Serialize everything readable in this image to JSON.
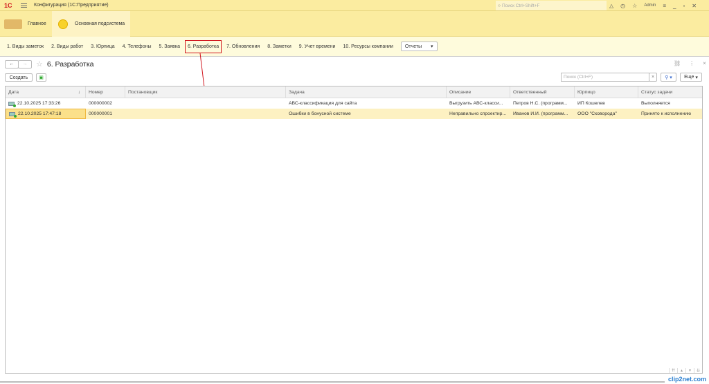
{
  "window": {
    "title": "Конфигурация  (1С:Предприятие)",
    "search_placeholder": "Поиск Ctrl+Shift+F",
    "user": "Admin",
    "logo": "1С"
  },
  "sections": [
    {
      "label": "Главное"
    },
    {
      "label": "Основная подсистема"
    }
  ],
  "nav": [
    "1. Виды заметок",
    "2. Виды работ",
    "3. Юрпица",
    "4. Телефоны",
    "5. Заявка",
    "6. Разработка",
    "7. Обновления",
    "8. Заметки",
    "9. Учет времени",
    "10. Ресурсы компании"
  ],
  "reports_label": "Отчеты",
  "form": {
    "title": "6. Разработка",
    "create_label": "Создать",
    "search_placeholder": "Поиск (Ctrl+F)",
    "more_label": "Еще"
  },
  "table": {
    "columns": [
      "Дата",
      "Номер",
      "Постановщик",
      "Задача",
      "Описание",
      "Ответственный",
      "Юрпицо",
      "Статус задачи"
    ],
    "rows": [
      [
        "22.10.2025 17:33:26",
        "000000002",
        "",
        "АВС-классификация для сайта",
        "Выгрузить АВС-класси...",
        "Петров Н.С. (программ...",
        "ИП Кошелев",
        "Выполняется"
      ],
      [
        "22.10.2025 17:47:18",
        "000000001",
        "",
        "Ошибки в бонусной системе",
        "Неправильно спроектир...",
        "Иванов И.И. (программ...",
        "ООО \"Сковорода\"",
        "Принято к исполнению"
      ]
    ]
  },
  "watermark": "clip2net.com",
  "colors": {
    "accent": "#fbeca0",
    "highlight": "#d0131b",
    "selection": "#fdf1c2"
  }
}
